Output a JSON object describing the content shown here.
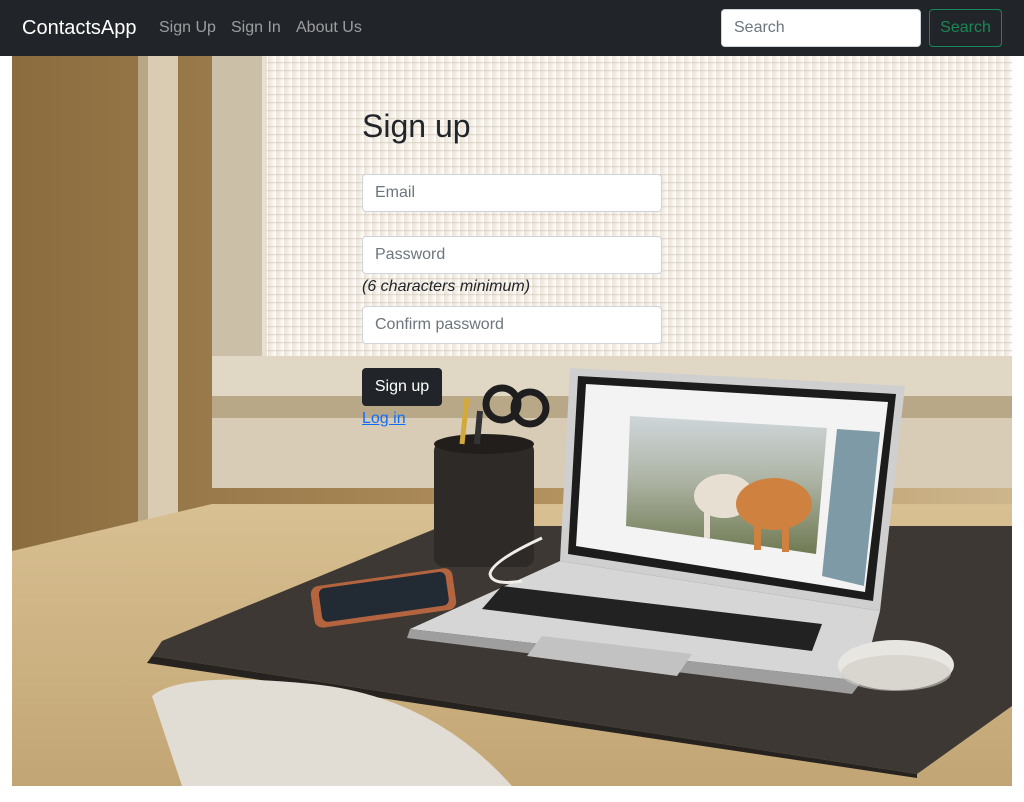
{
  "navbar": {
    "brand": "ContactsApp",
    "links": [
      "Sign Up",
      "Sign In",
      "About Us"
    ],
    "search": {
      "placeholder": "Search",
      "value": ""
    },
    "search_button": "Search"
  },
  "signup_form": {
    "title": "Sign up",
    "email_placeholder": "Email",
    "password_placeholder": "Password",
    "password_hint": "(6 characters minimum)",
    "confirm_placeholder": "Confirm password",
    "submit_label": "Sign up",
    "login_link": "Log in"
  },
  "colors": {
    "navbar_bg": "#212529",
    "nav_link": "rgba(255,255,255,0.55)",
    "search_button": "#198754",
    "primary_button": "#212529",
    "link": "#0d6efd"
  },
  "icons": [
    "background-photo-desk-laptop"
  ]
}
